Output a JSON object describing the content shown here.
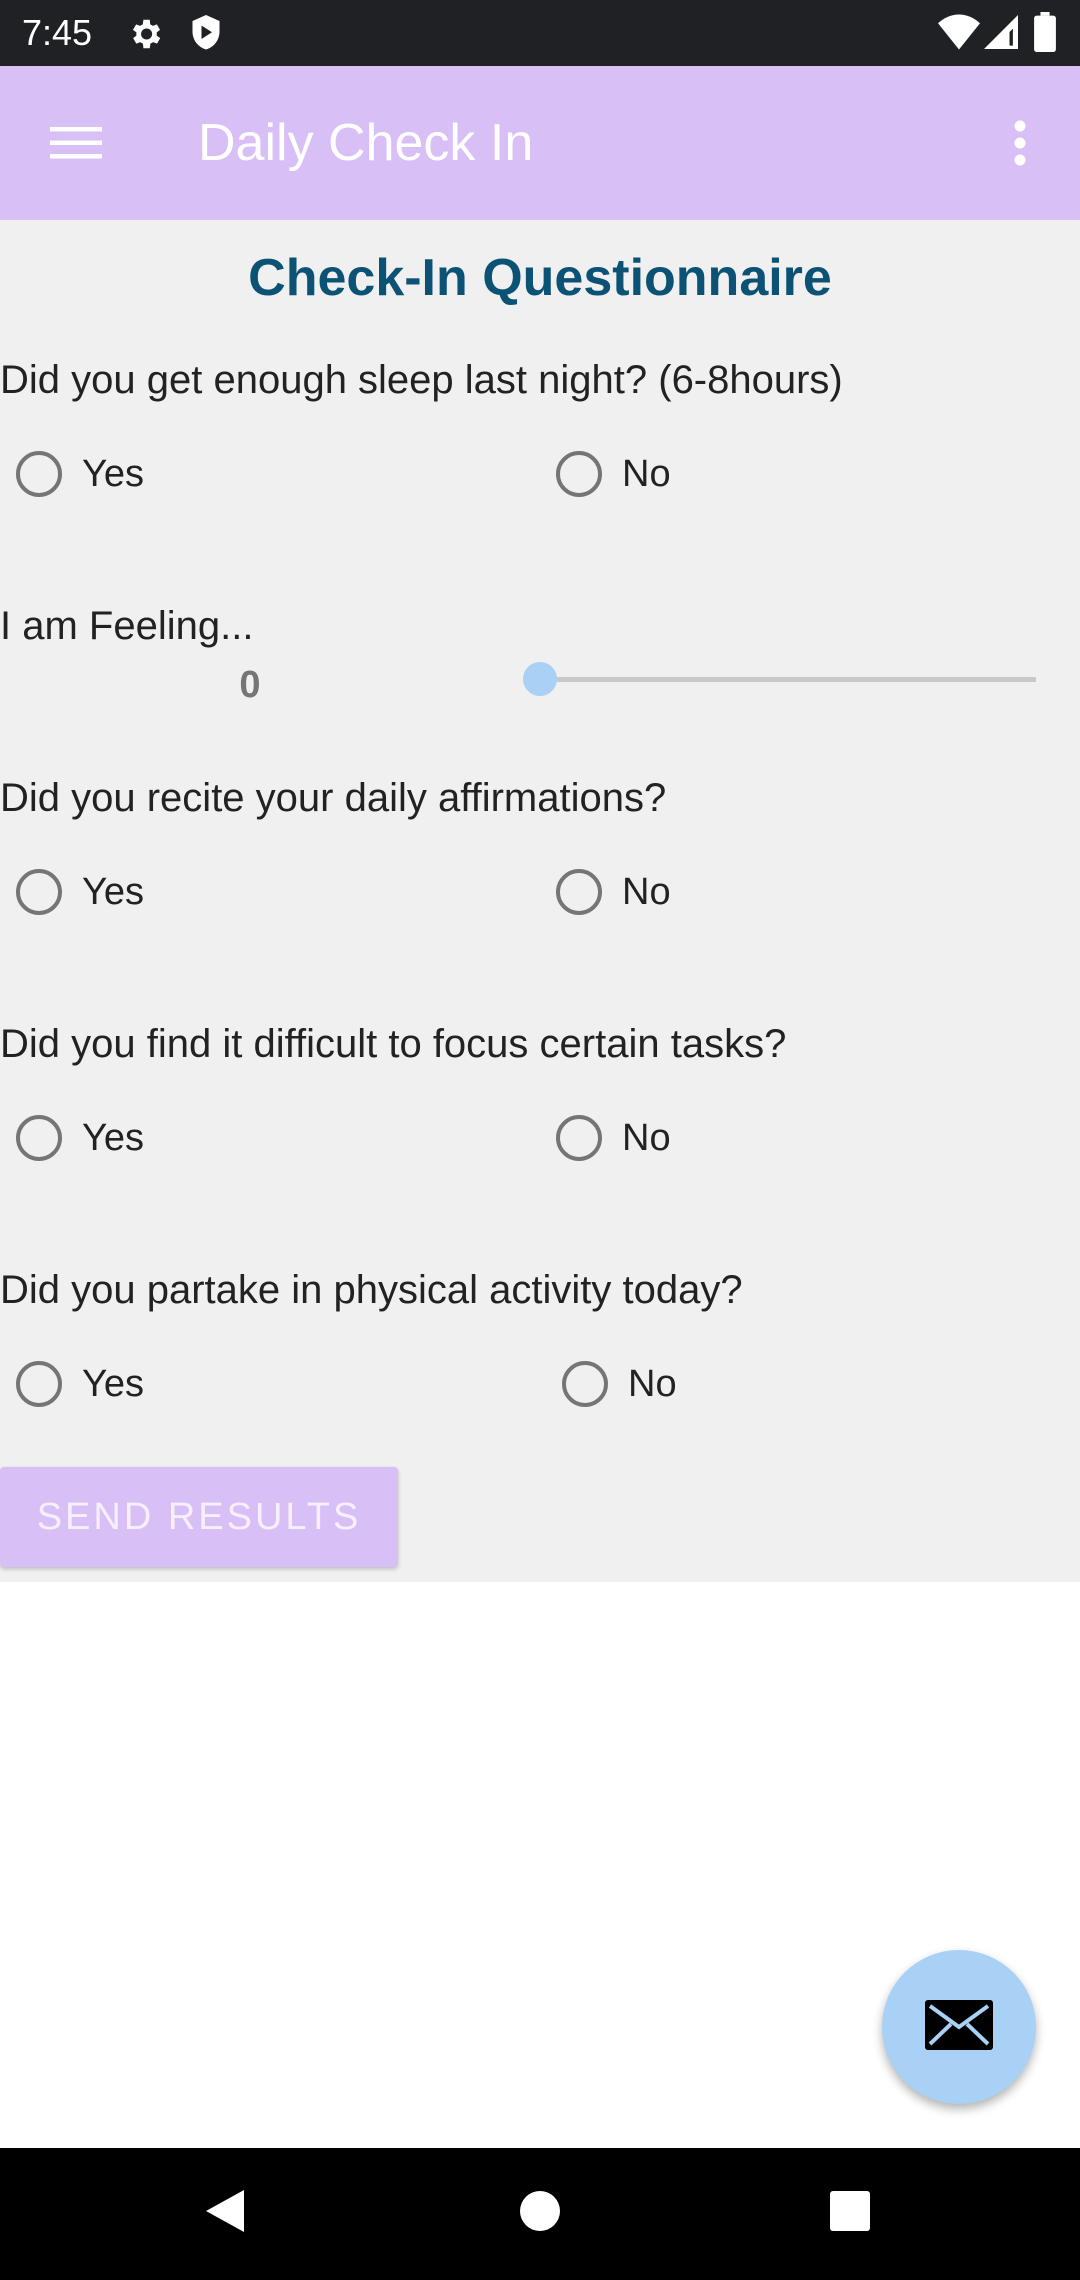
{
  "status_bar": {
    "time": "7:45",
    "icons": [
      "gear-icon",
      "shield-icon",
      "wifi-icon",
      "signal-icon",
      "battery-icon"
    ]
  },
  "app_bar": {
    "title": "Daily Check In",
    "menu_icon": "hamburger-menu-icon",
    "overflow_icon": "more-vert-icon",
    "background_color": "#d8bff5"
  },
  "page": {
    "title": "Check-In Questionnaire",
    "title_color": "#0b5274"
  },
  "questions": [
    {
      "text": "Did you get enough sleep last night? (6-8hours)",
      "yes": "Yes",
      "no": "No"
    },
    {
      "text": "Did you recite your daily affirmations?",
      "yes": "Yes",
      "no": "No"
    },
    {
      "text": "Did you find it difficult to focus certain tasks?",
      "yes": "Yes",
      "no": "No"
    },
    {
      "text": "Did you partake in physical activity today?",
      "yes": "Yes",
      "no": "No"
    }
  ],
  "feeling": {
    "label": "I am Feeling...",
    "value": "0",
    "slider_fraction": 0
  },
  "send_button": {
    "label": "SEND RESULTS"
  },
  "fab": {
    "icon": "mail-icon",
    "color": "#a9d0f5"
  },
  "nav_bar": {
    "icons": [
      "back-icon",
      "home-icon",
      "recents-icon"
    ]
  }
}
